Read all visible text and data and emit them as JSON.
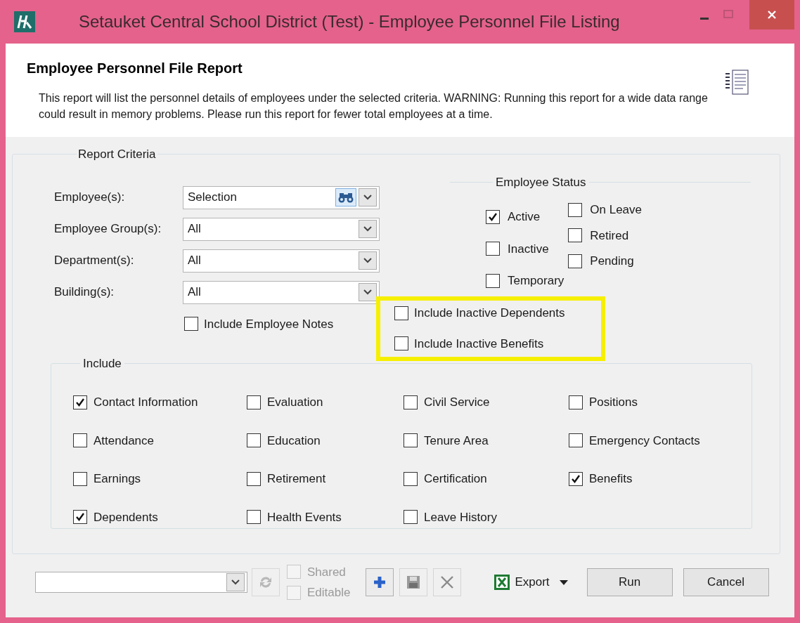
{
  "window": {
    "title": "Setauket Central School District (Test) - Employee Personnel File Listing"
  },
  "header": {
    "title": "Employee Personnel File Report",
    "description": "This report will list the personnel details of employees under the selected criteria.  WARNING:  Running this report for a wide data range could result in memory problems.  Please run this report for fewer total employees at a time."
  },
  "report_criteria": {
    "title": "Report Criteria",
    "fields": [
      {
        "label": "Employee(s):",
        "value": "Selection",
        "kind": "lookup"
      },
      {
        "label": "Employee Group(s):",
        "value": "All",
        "kind": "combo"
      },
      {
        "label": "Department(s):",
        "value": "All",
        "kind": "combo"
      },
      {
        "label": "Building(s):",
        "value": "All",
        "kind": "combo"
      }
    ],
    "employee_status": {
      "title": "Employee Status",
      "columns": [
        [
          {
            "label": "Active",
            "checked": true
          },
          {
            "label": "Inactive",
            "checked": false
          },
          {
            "label": "Temporary",
            "checked": false
          }
        ],
        [
          {
            "label": "On Leave",
            "checked": false
          },
          {
            "label": "Retired",
            "checked": false
          },
          {
            "label": "Pending",
            "checked": false
          }
        ]
      ]
    },
    "notes_option": {
      "label": "Include Employee Notes",
      "checked": false
    },
    "inactive_options": [
      {
        "label": "Include Inactive Dependents",
        "checked": false
      },
      {
        "label": "Include Inactive Benefits",
        "checked": false
      }
    ],
    "include": {
      "title": "Include",
      "items": [
        {
          "label": "Contact Information",
          "checked": true
        },
        {
          "label": "Evaluation",
          "checked": false
        },
        {
          "label": "Civil Service",
          "checked": false
        },
        {
          "label": "Positions",
          "checked": false
        },
        {
          "label": "Attendance",
          "checked": false
        },
        {
          "label": "Education",
          "checked": false
        },
        {
          "label": "Tenure Area",
          "checked": false
        },
        {
          "label": "Emergency Contacts",
          "checked": false
        },
        {
          "label": "Earnings",
          "checked": false
        },
        {
          "label": "Retirement",
          "checked": false
        },
        {
          "label": "Certification",
          "checked": false
        },
        {
          "label": "Benefits",
          "checked": true
        },
        {
          "label": "Dependents",
          "checked": true
        },
        {
          "label": "Health Events",
          "checked": false
        },
        {
          "label": "Leave History",
          "checked": false
        }
      ]
    }
  },
  "footer": {
    "options": [
      {
        "label": "Shared",
        "checked": false,
        "disabled": true
      },
      {
        "label": "Editable",
        "checked": false,
        "disabled": true
      }
    ],
    "export_label": "Export",
    "buttons": [
      "Run",
      "Cancel"
    ]
  }
}
